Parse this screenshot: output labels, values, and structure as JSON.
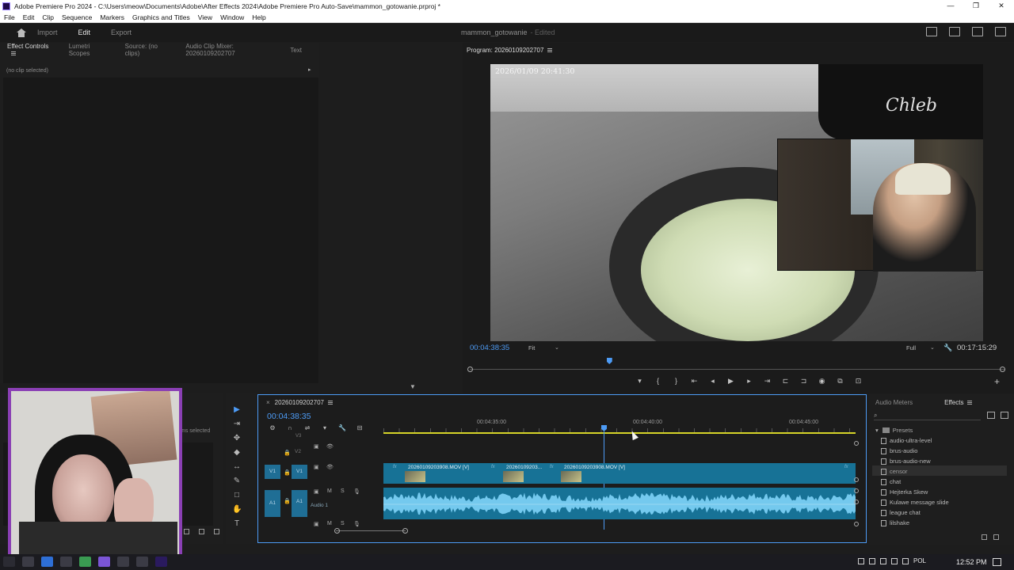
{
  "window": {
    "title": "Adobe Premiere Pro 2024 - C:\\Users\\meow\\Documents\\Adobe\\After Effects 2024\\Adobe Premiere Pro Auto-Save\\mammon_gotowanie.prproj *",
    "controls": [
      "—",
      "❐",
      "✕"
    ]
  },
  "menu": [
    "File",
    "Edit",
    "Clip",
    "Sequence",
    "Markers",
    "Graphics and Titles",
    "View",
    "Window",
    "Help"
  ],
  "header": {
    "nav": [
      "Import",
      "Edit",
      "Export"
    ],
    "active_nav": "Edit",
    "project_name": "mammon_gotowanie",
    "project_status": "- Edited"
  },
  "source_panel": {
    "tabs": [
      "Effect Controls",
      "Lumetri Scopes",
      "Source: (no clips)",
      "Audio Clip Mixer: 20260109202707",
      "Text"
    ],
    "message": "(no clip selected)"
  },
  "program_monitor": {
    "title": "Program: 20260109202707",
    "overlay_timestamp": "2026/01/09   20:41:30",
    "overlay_brand": "Chleb",
    "timecode": "00:04:38:35",
    "fit": "Fit",
    "resolution": "Full",
    "duration": "00:17:15:29",
    "playhead_fraction": 0.26,
    "transport": [
      "▾",
      "{",
      "}",
      "⇤",
      "◂",
      "▶",
      "▸",
      "⇥",
      "⊏",
      "⊐",
      "◉",
      "⧉",
      "⊡"
    ],
    "add_button": "+"
  },
  "project_panel": {
    "items_selected": "ms selected"
  },
  "tools": [
    "▶",
    "⇥",
    "✥",
    "◆",
    "↔",
    "✎",
    "□",
    "✋",
    "T"
  ],
  "timeline": {
    "sequence_name": "20260109202707",
    "timecode": "00:04:38:35",
    "ruler_labels": [
      "00:04:35:00",
      "00:04:40:00",
      "00:04:45:00"
    ],
    "tracks": {
      "v3": "V3",
      "v2": "V2",
      "v1": "V1",
      "a1": "A1",
      "a1_name": "Audio 1"
    },
    "clips": [
      {
        "label": "20260109203908.MOV [V]"
      },
      {
        "label": "20260109203..."
      },
      {
        "label": "20260109203908.MOV [V]"
      }
    ],
    "icons": [
      "⚙",
      "∩",
      "⇌",
      "▾",
      "🔧",
      "⊟"
    ]
  },
  "effects_panel": {
    "tabs": [
      "Audio Meters",
      "Effects"
    ],
    "active_tab": "Effects",
    "folder": "Presets",
    "presets": [
      "audio-ultra-level",
      "brus-audio",
      "brus-audio-new",
      "censor",
      "chat",
      "Hejterka Skew",
      "Kulawe message slide",
      "league chat",
      "lilshake"
    ],
    "selected_preset": "censor"
  },
  "taskbar": {
    "language": "POL",
    "time": "12:52 PM"
  }
}
